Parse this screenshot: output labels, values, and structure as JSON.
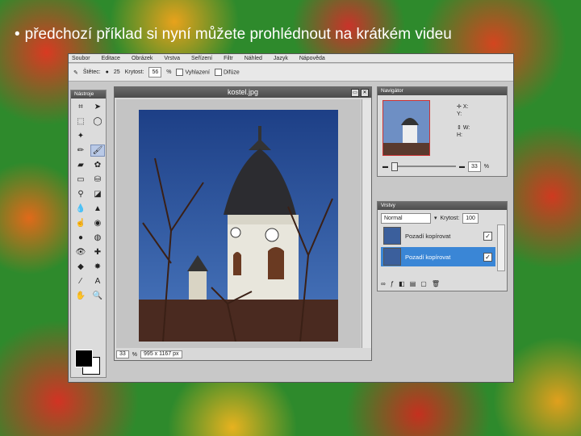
{
  "slide": {
    "bullet": "•",
    "title": "předchozí příklad si nyní můžete prohlédnout na krátkém videu"
  },
  "app": {
    "menu": [
      "Soubor",
      "Editace",
      "Obrázek",
      "Vrstva",
      "Seřízení",
      "Filtr",
      "Náhled",
      "Jazyk",
      "Nápověda"
    ],
    "toolbar": {
      "brush_label": "Štětec:",
      "brush_size": "25",
      "hardness_label": "Krytost:",
      "hardness_value": "56",
      "unit": "%",
      "antialias_label": "Vyhlazení",
      "diffuse_label": "Difúze"
    },
    "toolbox": {
      "title": "Nástroje"
    },
    "document": {
      "title": "kostel.jpg",
      "zoom": "33",
      "zoom_unit": "%",
      "size": "995 x 1167 px"
    },
    "navigator": {
      "title": "Navigátor",
      "x_label": "X:",
      "y_label": "Y:",
      "w_label": "W:",
      "h_label": "H:",
      "zoom": "33",
      "zoom_unit": "%"
    },
    "layers": {
      "title": "Vrstvy",
      "blend_mode": "Normal",
      "opacity_label": "Krytost:",
      "opacity_value": "100",
      "items": [
        {
          "name": "Pozadí kopírovat",
          "visible": true
        },
        {
          "name": "Pozadí kopírovat",
          "visible": true,
          "selected": true
        }
      ]
    }
  },
  "colors": {
    "panel_header": "#555555",
    "selection": "#3a86d6",
    "slide_bg": "#2e8a2c"
  }
}
